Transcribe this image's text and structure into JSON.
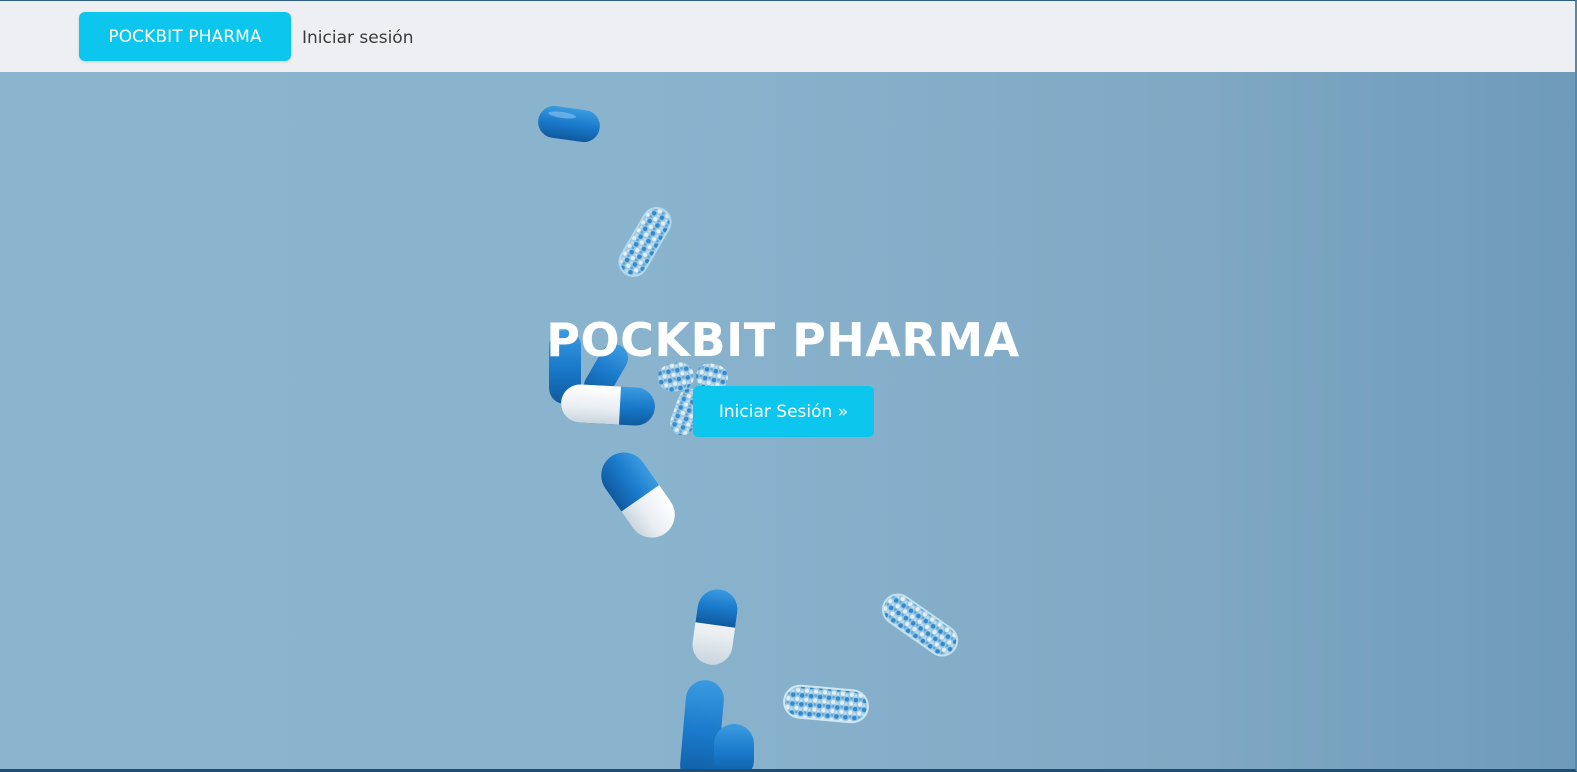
{
  "navbar": {
    "brand_label": "POCKBIT PHARMA",
    "login_link": "Iniciar sesión"
  },
  "hero": {
    "title": "POCKBIT PHARMA",
    "cta_label": "Iniciar Sesión »"
  },
  "colors": {
    "accent": "#0dc6ee",
    "navbar_bg": "#eeeff2",
    "hero_bg": "#8ab4ce",
    "capsule_blue": "#1776c4",
    "capsule_white": "#eef3f6"
  },
  "icons": {
    "hero_background": "falling-capsules-image"
  }
}
